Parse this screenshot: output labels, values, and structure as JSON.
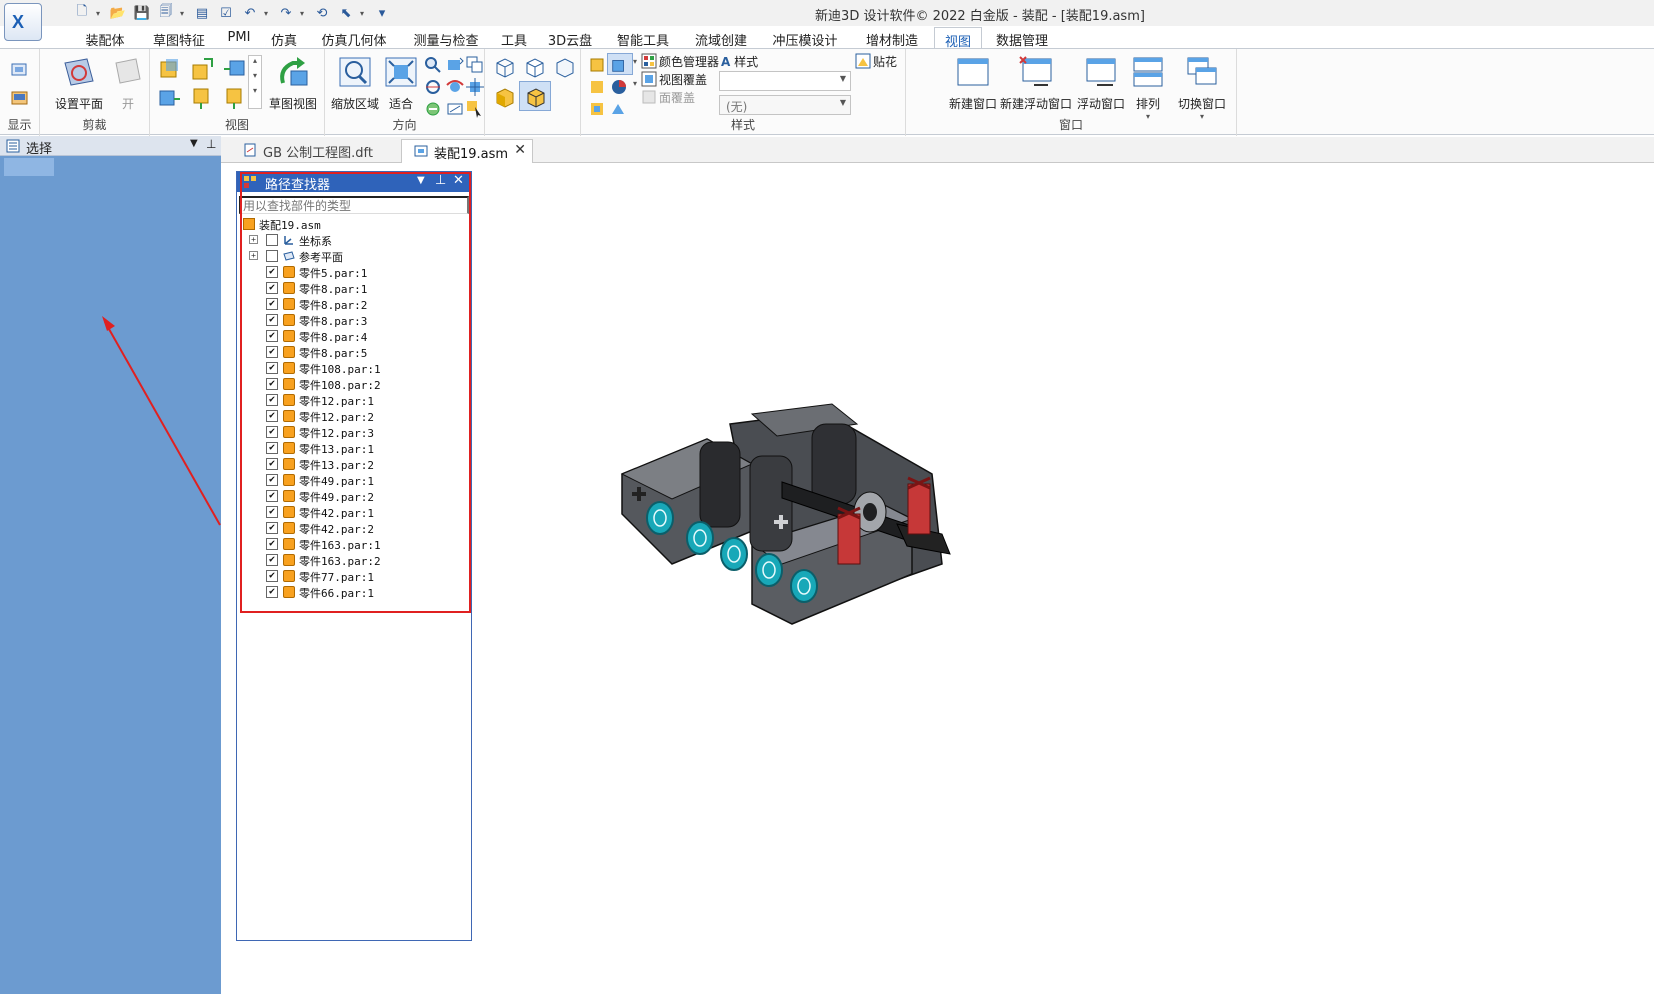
{
  "window": {
    "title": "新迪3D 设计软件© 2022 白金版 - 装配 - [装配19.asm]",
    "logo_text": "X"
  },
  "quick_access": [
    "new-icon",
    "open-icon",
    "save-icon",
    "save-all-icon",
    "undo-icon",
    "redo-icon",
    "select-icon"
  ],
  "ribbon_tabs": [
    {
      "label": "装配体"
    },
    {
      "label": "草图特征"
    },
    {
      "label": "PMI"
    },
    {
      "label": "仿真"
    },
    {
      "label": "仿真几何体"
    },
    {
      "label": "测量与检查"
    },
    {
      "label": "工具"
    },
    {
      "label": "3D云盘"
    },
    {
      "label": "智能工具"
    },
    {
      "label": "流域创建"
    },
    {
      "label": "冲压模设计"
    },
    {
      "label": "增材制造"
    },
    {
      "label": "视图",
      "active": true
    },
    {
      "label": "数据管理"
    }
  ],
  "ribbon": {
    "show_group_label": "显示",
    "clip": {
      "label": "剪裁",
      "set_plane": "设置平面",
      "open": "开"
    },
    "view": {
      "label": "视图",
      "sketch_view": "草图视图"
    },
    "orientation": {
      "label": "方向",
      "zoom_area": "缩放区域",
      "fit": "适合"
    },
    "style": {
      "label": "样式",
      "color_manager": "颜色管理器",
      "view_override": "视图覆盖",
      "face_override": "面覆盖",
      "style_label": "样式",
      "decal": "贴花",
      "style_value": "",
      "style2_value": "(无)"
    },
    "window": {
      "label": "窗口",
      "new_window": "新建窗口",
      "new_floating_window": "新建浮动窗口",
      "floating_window": "浮动窗口",
      "arrange": "排列",
      "switch_window": "切换窗口"
    }
  },
  "left_panel": {
    "title": "选择"
  },
  "doc_tabs": [
    {
      "label": "GB 公制工程图.dft",
      "active": false
    },
    {
      "label": "装配19.asm",
      "active": true
    }
  ],
  "path_finder": {
    "title": "路径查找器",
    "search_placeholder": "用以查找部件的类型",
    "root": "装配19.asm",
    "folders": [
      {
        "label": "坐标系",
        "checked": false
      },
      {
        "label": "参考平面",
        "checked": false
      }
    ],
    "parts": [
      "零件5.par:1",
      "零件8.par:1",
      "零件8.par:2",
      "零件8.par:3",
      "零件8.par:4",
      "零件8.par:5",
      "零件108.par:1",
      "零件108.par:2",
      "零件12.par:1",
      "零件12.par:2",
      "零件12.par:3",
      "零件13.par:1",
      "零件13.par:2",
      "零件49.par:1",
      "零件49.par:2",
      "零件42.par:1",
      "零件42.par:2",
      "零件163.par:1",
      "零件163.par:2",
      "零件77.par:1",
      "零件66.par:1"
    ]
  },
  "colors": {
    "accent": "#2f63ba",
    "left_panel_bg": "#6c9bd0",
    "highlight": "#e02020",
    "part_body": "#5e6166",
    "part_cyan": "#18a8b8",
    "part_red": "#d23a3a"
  }
}
